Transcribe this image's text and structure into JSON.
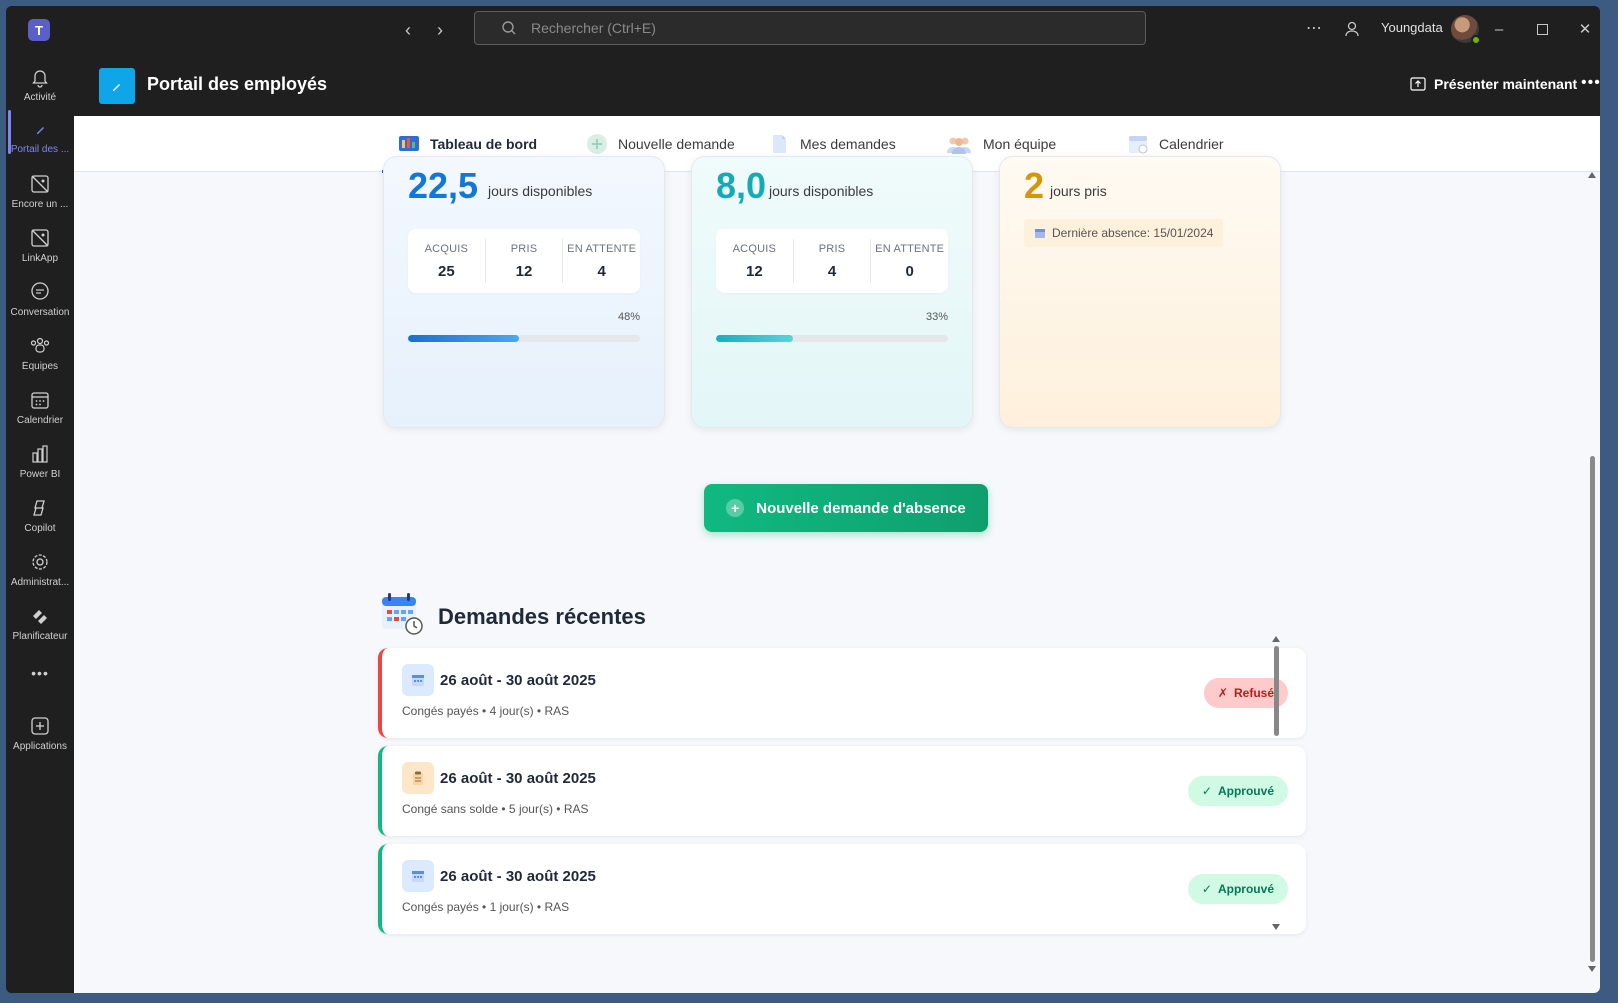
{
  "titlebar": {
    "search_placeholder": "Rechercher (Ctrl+E)",
    "user_name": "Youngdata"
  },
  "rail": {
    "items": [
      {
        "label": "Activité",
        "icon": "bell-icon"
      },
      {
        "label": "Portail des ...",
        "icon": "edit-icon"
      },
      {
        "label": "Encore un ...",
        "icon": "app-placeholder-icon"
      },
      {
        "label": "LinkApp",
        "icon": "app-placeholder-icon"
      },
      {
        "label": "Conversation",
        "icon": "chat-icon"
      },
      {
        "label": "Équipes",
        "icon": "teams-icon"
      },
      {
        "label": "Calendrier",
        "icon": "calendar-icon"
      },
      {
        "label": "Power BI",
        "icon": "chart-icon"
      },
      {
        "label": "Copilot",
        "icon": "copilot-icon"
      },
      {
        "label": "Administrat...",
        "icon": "admin-icon"
      },
      {
        "label": "Planificateur",
        "icon": "planner-icon"
      },
      {
        "label": "Applications",
        "icon": "add-app-icon"
      }
    ],
    "more": "•••"
  },
  "header": {
    "title": "Portail des employés",
    "present_label": "Présenter maintenant",
    "more": "•••"
  },
  "tabs": [
    {
      "label": "Tableau de bord",
      "icon": "dashboard-icon",
      "active": true
    },
    {
      "label": "Nouvelle demande",
      "icon": "add-icon",
      "active": false
    },
    {
      "label": "Mes demandes",
      "icon": "document-icon",
      "active": false
    },
    {
      "label": "Mon équipe",
      "icon": "team-icon",
      "active": false
    },
    {
      "label": "Calendrier",
      "icon": "calendar-icon",
      "active": false
    }
  ],
  "cards": [
    {
      "value": "22,5",
      "unit": "jours disponibles",
      "stats": [
        {
          "label": "ACQUIS",
          "value": "25"
        },
        {
          "label": "PRIS",
          "value": "12"
        },
        {
          "label": "EN ATTENTE",
          "value": "4"
        }
      ],
      "percent_label": "48%",
      "progress": 0.48,
      "color": "#1377d8"
    },
    {
      "value": "8,0",
      "unit": "jours disponibles",
      "stats": [
        {
          "label": "ACQUIS",
          "value": "12"
        },
        {
          "label": "PRIS",
          "value": "4"
        },
        {
          "label": "EN ATTENTE",
          "value": "0"
        }
      ],
      "percent_label": "33%",
      "progress": 0.33,
      "color": "#15aab8"
    },
    {
      "value": "2",
      "unit": "jours pris",
      "last_absence": "Dernière absence: 15/01/2024",
      "color": "#d4960e"
    }
  ],
  "cta": {
    "label": "Nouvelle demande d'absence",
    "plus": "+"
  },
  "recent": {
    "title": "Demandes récentes",
    "items": [
      {
        "dates": "26 août - 30 août 2025",
        "details": "Congés payés • 4 jour(s) • RAS",
        "status": "Refusé",
        "status_mark": "✗",
        "type_icon": "calendar-icon",
        "status_color": "#ef4444"
      },
      {
        "dates": "26 août - 30 août 2025",
        "details": "Congé sans solde • 5 jour(s) • RAS",
        "status": "Approuvé",
        "status_mark": "✓",
        "type_icon": "clipboard-icon",
        "status_color": "#10b981"
      },
      {
        "dates": "26 août - 30 août 2025",
        "details": "Congés payés • 1 jour(s) • RAS",
        "status": "Approuvé",
        "status_mark": "✓",
        "type_icon": "calendar-icon",
        "status_color": "#10b981"
      }
    ]
  }
}
